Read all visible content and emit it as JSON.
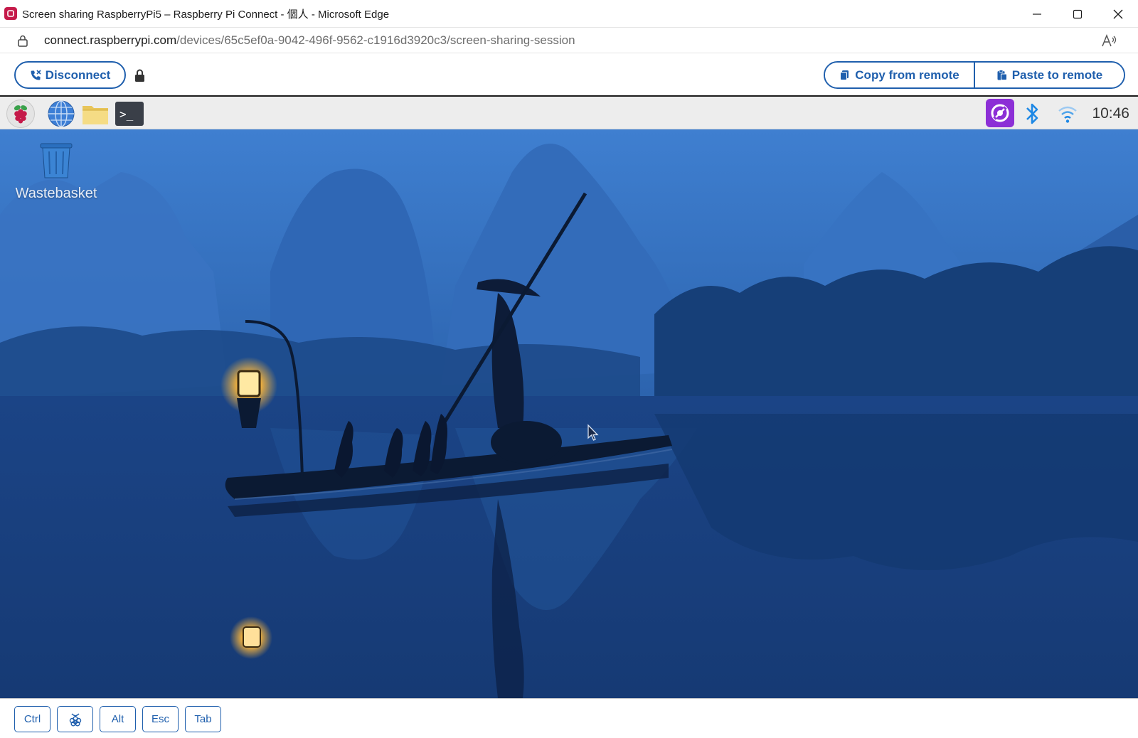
{
  "window": {
    "title": "Screen sharing RaspberryPi5 – Raspberry Pi Connect - 個人 - Microsoft Edge"
  },
  "address": {
    "host": "connect.raspberrypi.com",
    "path": "/devices/65c5ef0a-9042-496f-9562-c1916d3920c3/screen-sharing-session"
  },
  "toolbar": {
    "disconnect_label": "Disconnect",
    "copy_label": "Copy from remote",
    "paste_label": "Paste to remote"
  },
  "remote": {
    "clock": "10:46",
    "desktop_icons": [
      {
        "label": "Wastebasket",
        "icon": "wastebasket-icon"
      }
    ]
  },
  "keys": {
    "items": [
      "Ctrl",
      "raspberry-key",
      "Alt",
      "Esc",
      "Tab"
    ],
    "ctrl": "Ctrl",
    "alt": "Alt",
    "esc": "Esc",
    "tab": "Tab"
  },
  "colors": {
    "accent": "#1f5fad",
    "favicon": "#c51a4a",
    "connect_tray": "#8c2fd6"
  }
}
